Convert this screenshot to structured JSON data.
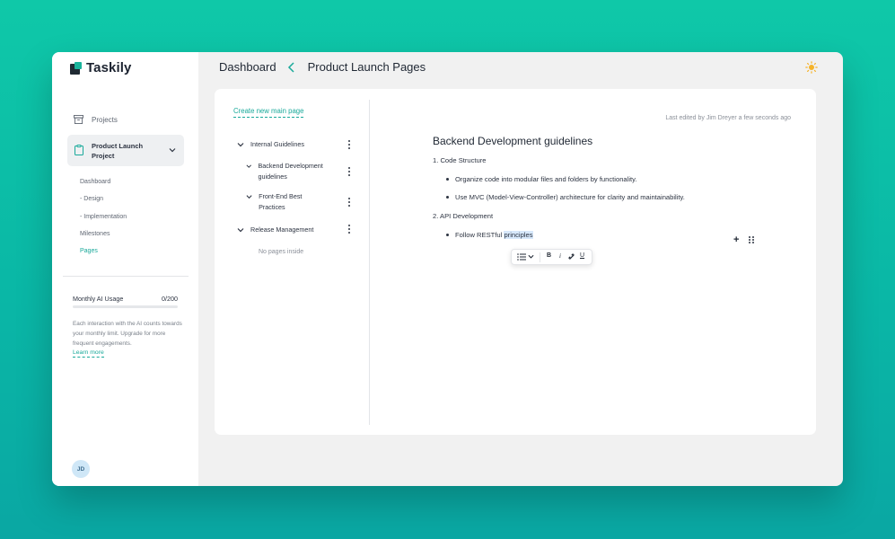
{
  "brand": {
    "name": "Taskily"
  },
  "sidebar": {
    "projects_label": "Projects",
    "current_project": "Product Launch Project",
    "subnav": [
      "Dashboard",
      "- Design",
      "- Implementation",
      "Milestones",
      "Pages"
    ],
    "active_subnav": "Pages",
    "ai_usage": {
      "title": "Monthly AI Usage",
      "count": "0/200",
      "used_fraction": 0,
      "description": "Each interaction with the AI counts towards your monthly limit. Upgrade for more frequent engagements.",
      "learn_more": "Learn more"
    },
    "avatar_initials": "JD"
  },
  "header": {
    "crumb_root": "Dashboard",
    "crumb_current": "Product Launch Pages",
    "theme_icon": "sun-icon"
  },
  "pages_tree": {
    "create_link": "Create new main page",
    "items": [
      {
        "label": "Internal Guidelines"
      },
      {
        "label": "Backend Development guidelines"
      },
      {
        "label": "Front-End Best Practices"
      },
      {
        "label": "Release Management"
      }
    ],
    "empty_text": "No pages inside"
  },
  "document": {
    "last_edited": "Last edited by Jim Dreyer a few seconds ago",
    "title": "Backend Development guidelines",
    "sections": [
      {
        "heading": "1. Code Structure",
        "bullets": [
          "Organize code into modular files and folders by functionality.",
          "Use MVC (Model-View-Controller) architecture for clarity and maintainability."
        ]
      },
      {
        "heading": "2. API Development",
        "bullet_prefix": "Follow RESTful ",
        "bullet_selected": "principles"
      }
    ]
  },
  "toolbar": {
    "bold": "B",
    "italic": "i",
    "underline": "U"
  },
  "colors": {
    "accent": "#19b39b",
    "background": "#0fc8a8",
    "sun": "#f5b32a"
  }
}
